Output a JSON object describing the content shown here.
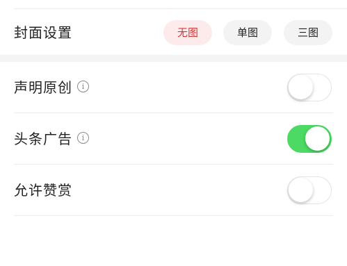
{
  "cover": {
    "label": "封面设置",
    "options": [
      "无图",
      "单图",
      "三图"
    ],
    "selected": "无图"
  },
  "settings": [
    {
      "label": "声明原创",
      "info_icon": "i",
      "enabled": false
    },
    {
      "label": "头条广告",
      "info_icon": "i",
      "enabled": true
    },
    {
      "label": "允许赞赏",
      "enabled": false
    }
  ],
  "colors": {
    "accent": "#d23a3a",
    "accent_bg": "#fdeaea",
    "toggle_on": "#4cd964"
  }
}
